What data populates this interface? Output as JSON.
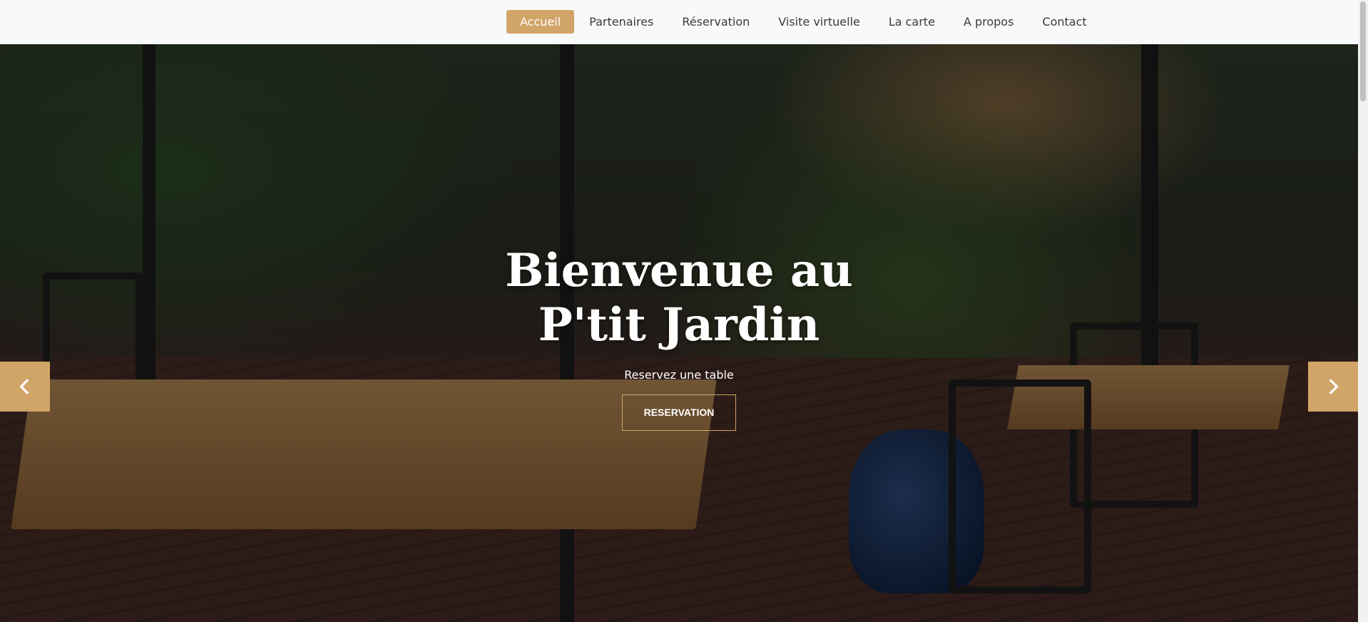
{
  "nav": {
    "items": [
      {
        "label": "Accueil",
        "active": true
      },
      {
        "label": "Partenaires",
        "active": false
      },
      {
        "label": "Réservation",
        "active": false
      },
      {
        "label": "Visite virtuelle",
        "active": false
      },
      {
        "label": "La carte",
        "active": false
      },
      {
        "label": "A propos",
        "active": false
      },
      {
        "label": "Contact",
        "active": false
      }
    ]
  },
  "hero": {
    "title_line1": "Bienvenue au",
    "title_line2": "P'tit Jardin",
    "subtitle": "Reservez une table",
    "button_label": "RESERVATION"
  },
  "carousel": {
    "prev_icon": "chevron-left-icon",
    "next_icon": "chevron-right-icon"
  },
  "colors": {
    "accent": "#d1a468",
    "nav_background": "#f8f9fa",
    "nav_text": "#3a3a3a"
  }
}
